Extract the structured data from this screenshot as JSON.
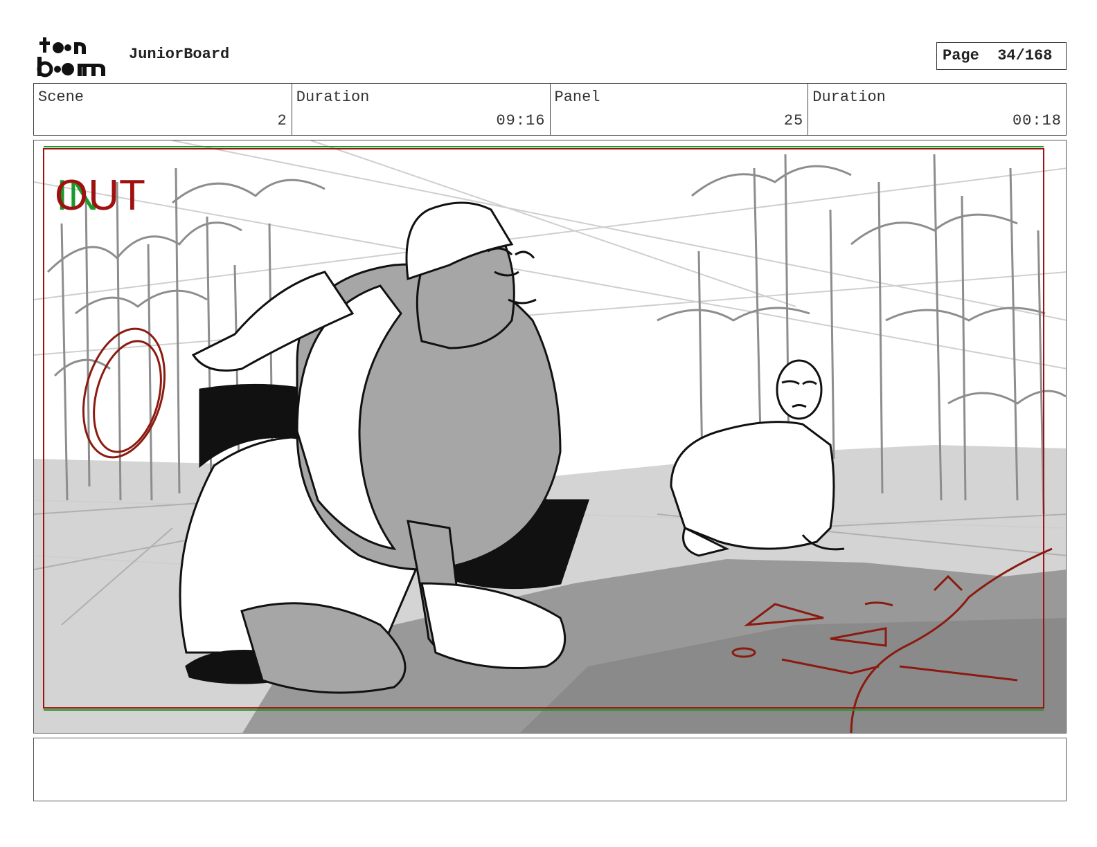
{
  "header": {
    "logo_text": "toonboom",
    "app_name": "JuniorBoard",
    "page_label": "Page",
    "page_value": "34/168"
  },
  "info": {
    "scene_label": "Scene",
    "scene_value": "2",
    "scene_duration_label": "Duration",
    "scene_duration_value": "09:16",
    "panel_label": "Panel",
    "panel_value": "25",
    "panel_duration_label": "Duration",
    "panel_duration_value": "00:18"
  },
  "panel": {
    "in_marker": "IN",
    "out_marker": "OUT",
    "in_color": "#1a9a2a",
    "out_color": "#a01010",
    "safe_frame_color": "#a01010"
  },
  "notes": {
    "text": ""
  }
}
